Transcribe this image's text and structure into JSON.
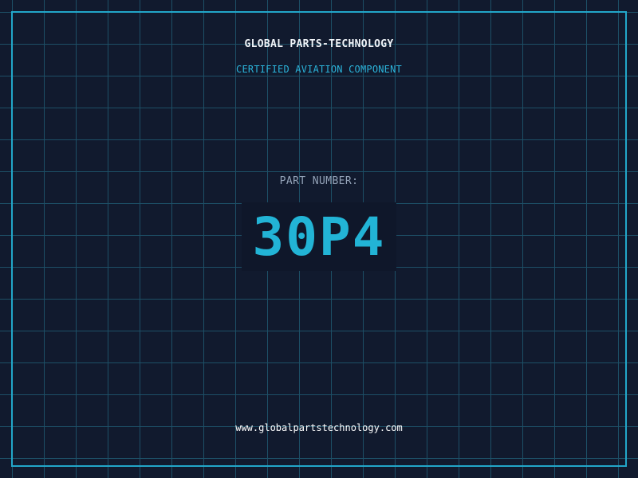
{
  "header": {
    "brand": "GLOBAL PARTS-TECHNOLOGY",
    "tagline": "CERTIFIED AVIATION COMPONENT"
  },
  "part": {
    "label": "PART NUMBER:",
    "number": "30P4"
  },
  "footer": {
    "website": "www.globalpartstechnology.com"
  },
  "colors": {
    "background": "#111a2e",
    "grid": "#1d4f66",
    "frame": "#22a6c9",
    "accent": "#22b4d6",
    "brand_text": "#f1f5f9",
    "label_text": "#94a3b8"
  }
}
